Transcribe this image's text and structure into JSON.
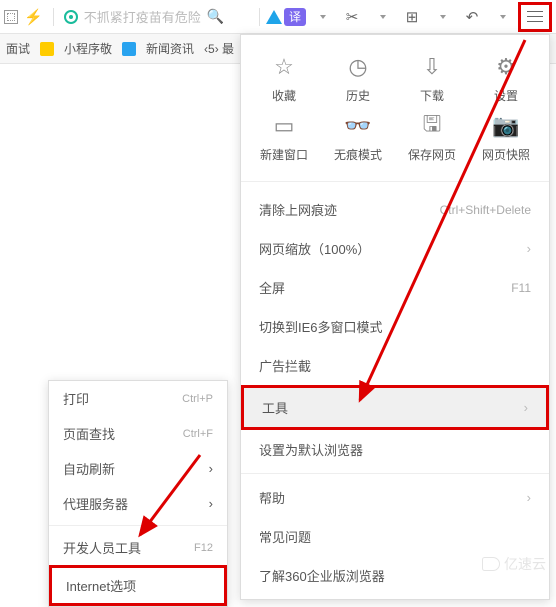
{
  "toolbar": {
    "addressPlaceholder": "不抓紧打疫苗有危险",
    "translateLabel": "译"
  },
  "tabstrip": {
    "tab1": "面试",
    "tab2": "小程序敬",
    "tab3": "新闻资讯",
    "tab4": "‹5› 最"
  },
  "menu": {
    "grid": [
      {
        "label": "收藏",
        "icon": "star"
      },
      {
        "label": "历史",
        "icon": "clock"
      },
      {
        "label": "下载",
        "icon": "download"
      },
      {
        "label": "设置",
        "icon": "gear"
      },
      {
        "label": "新建窗口",
        "icon": "window"
      },
      {
        "label": "无痕模式",
        "icon": "incognito"
      },
      {
        "label": "保存网页",
        "icon": "save"
      },
      {
        "label": "网页快照",
        "icon": "camera"
      }
    ],
    "clearHistory": {
      "label": "清除上网痕迹",
      "hint": "Ctrl+Shift+Delete"
    },
    "zoom": {
      "label": "网页缩放（100%）"
    },
    "fullscreen": {
      "label": "全屏",
      "hint": "F11"
    },
    "ie6mode": {
      "label": "切换到IE6多窗口模式"
    },
    "adblock": {
      "label": "广告拦截"
    },
    "tools": {
      "label": "工具"
    },
    "setDefault": {
      "label": "设置为默认浏览器"
    },
    "help": {
      "label": "帮助"
    },
    "faq": {
      "label": "常见问题"
    },
    "enterprise": {
      "label": "了解360企业版浏览器"
    }
  },
  "submenu": {
    "print": {
      "label": "打印",
      "hint": "Ctrl+P"
    },
    "findInPage": {
      "label": "页面查找",
      "hint": "Ctrl+F"
    },
    "autoRefresh": {
      "label": "自动刷新"
    },
    "proxy": {
      "label": "代理服务器"
    },
    "devTools": {
      "label": "开发人员工具",
      "hint": "F12"
    },
    "internetOptions": {
      "label": "Internet选项"
    }
  },
  "watermark": "亿速云"
}
